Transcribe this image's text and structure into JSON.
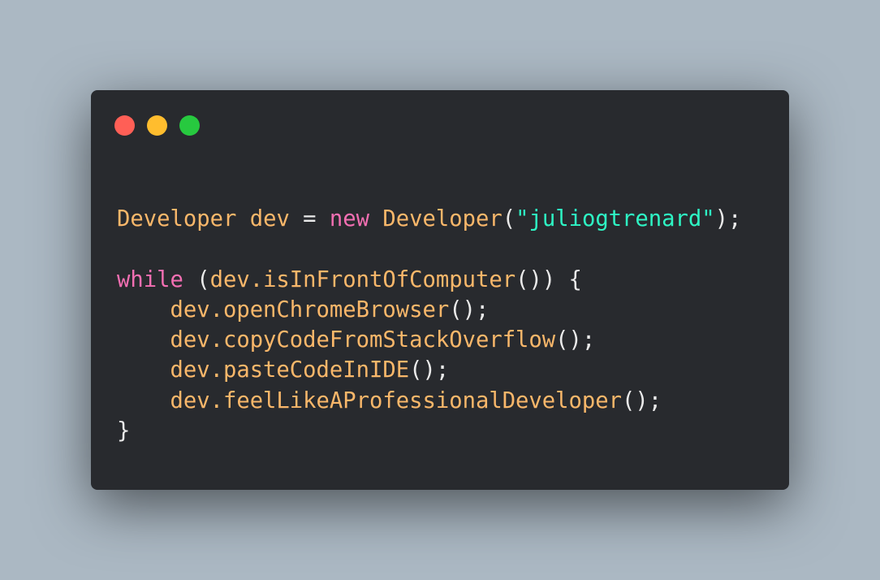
{
  "window": {
    "controls": [
      {
        "name": "close",
        "color": "#ff5f56"
      },
      {
        "name": "minimize",
        "color": "#ffbd2e"
      },
      {
        "name": "maximize",
        "color": "#27c93f"
      }
    ]
  },
  "colors": {
    "background": "#abb8c3",
    "window": "#282a2e",
    "plain": "#eaeaea",
    "identifier": "#f9b76a",
    "keyword": "#f36fb2",
    "string": "#2ef5c4"
  },
  "code": {
    "lines": [
      [
        {
          "t": "Developer",
          "k": "identifier"
        },
        {
          "t": " ",
          "k": "plain"
        },
        {
          "t": "dev",
          "k": "identifier"
        },
        {
          "t": " = ",
          "k": "plain"
        },
        {
          "t": "new",
          "k": "keyword"
        },
        {
          "t": " ",
          "k": "plain"
        },
        {
          "t": "Developer",
          "k": "identifier"
        },
        {
          "t": "(",
          "k": "plain"
        },
        {
          "t": "\"juliogtrenard\"",
          "k": "string"
        },
        {
          "t": ");",
          "k": "plain"
        }
      ],
      [],
      [
        {
          "t": "while",
          "k": "keyword"
        },
        {
          "t": " (",
          "k": "plain"
        },
        {
          "t": "dev.isInFrontOfComputer",
          "k": "identifier"
        },
        {
          "t": "()) {",
          "k": "plain"
        }
      ],
      [
        {
          "t": "    ",
          "k": "plain"
        },
        {
          "t": "dev.openChromeBrowser",
          "k": "identifier"
        },
        {
          "t": "();",
          "k": "plain"
        }
      ],
      [
        {
          "t": "    ",
          "k": "plain"
        },
        {
          "t": "dev.copyCodeFromStackOverflow",
          "k": "identifier"
        },
        {
          "t": "();",
          "k": "plain"
        }
      ],
      [
        {
          "t": "    ",
          "k": "plain"
        },
        {
          "t": "dev.pasteCodeInIDE",
          "k": "identifier"
        },
        {
          "t": "();",
          "k": "plain"
        }
      ],
      [
        {
          "t": "    ",
          "k": "plain"
        },
        {
          "t": "dev.feelLikeAProfessionalDeveloper",
          "k": "identifier"
        },
        {
          "t": "();",
          "k": "plain"
        }
      ],
      [
        {
          "t": "}",
          "k": "plain"
        }
      ]
    ]
  }
}
